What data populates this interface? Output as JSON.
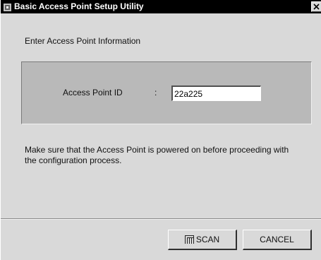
{
  "window": {
    "title": "Basic Access Point Setup Utility"
  },
  "main": {
    "heading": "Enter Access Point Information",
    "field_label": "Access Point ID",
    "field_colon": ":",
    "access_point_id_value": "22a225",
    "note": "Make sure that the Access Point is powered on before proceeding with the configuration process."
  },
  "buttons": {
    "scan_label": "SCAN",
    "cancel_label": "CANCEL"
  },
  "icons": {
    "app": "app-icon",
    "close": "close-icon",
    "scan": "scan-icon"
  }
}
